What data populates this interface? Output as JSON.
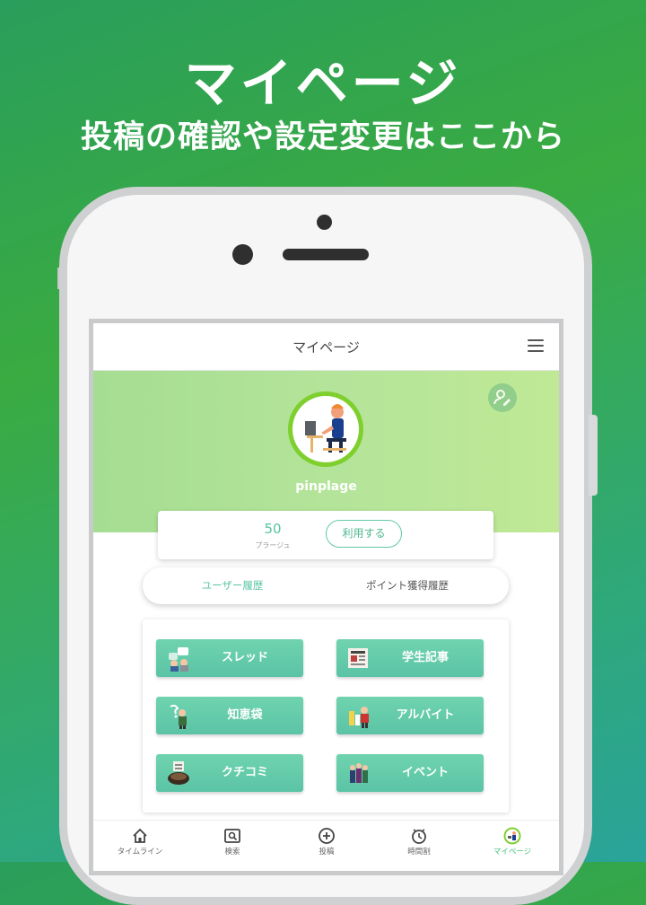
{
  "promo": {
    "title": "マイページ",
    "subtitle": "投稿の確認や設定変更はここから"
  },
  "app": {
    "header_title": "マイページ",
    "username": "pinplage",
    "points": {
      "value": "50",
      "unit": "プラージュ",
      "use_button": "利用する"
    },
    "tabs": [
      {
        "label": "ユーザー履歴",
        "active": true
      },
      {
        "label": "ポイント獲得履歴",
        "active": false
      }
    ],
    "categories": [
      {
        "label": "スレッド",
        "icon": "thread-illustration-icon"
      },
      {
        "label": "学生記事",
        "icon": "newspaper-illustration-icon"
      },
      {
        "label": "知恵袋",
        "icon": "knowledge-illustration-icon"
      },
      {
        "label": "アルバイト",
        "icon": "part-time-job-illustration-icon"
      },
      {
        "label": "クチコミ",
        "icon": "review-illustration-icon"
      },
      {
        "label": "イベント",
        "icon": "event-illustration-icon"
      }
    ],
    "bottom_nav": [
      {
        "label": "タイムライン",
        "icon": "home-icon",
        "active": false
      },
      {
        "label": "検索",
        "icon": "search-icon",
        "active": false
      },
      {
        "label": "投稿",
        "icon": "plus-circle-icon",
        "active": false
      },
      {
        "label": "時間割",
        "icon": "clock-icon",
        "active": false
      },
      {
        "label": "マイページ",
        "icon": "avatar-icon",
        "active": true
      }
    ]
  },
  "colors": {
    "accent": "#5bc4a6",
    "hero": "#b6e59a",
    "background_green": "#3aab41",
    "avatar_ring": "#7fcf2e"
  }
}
